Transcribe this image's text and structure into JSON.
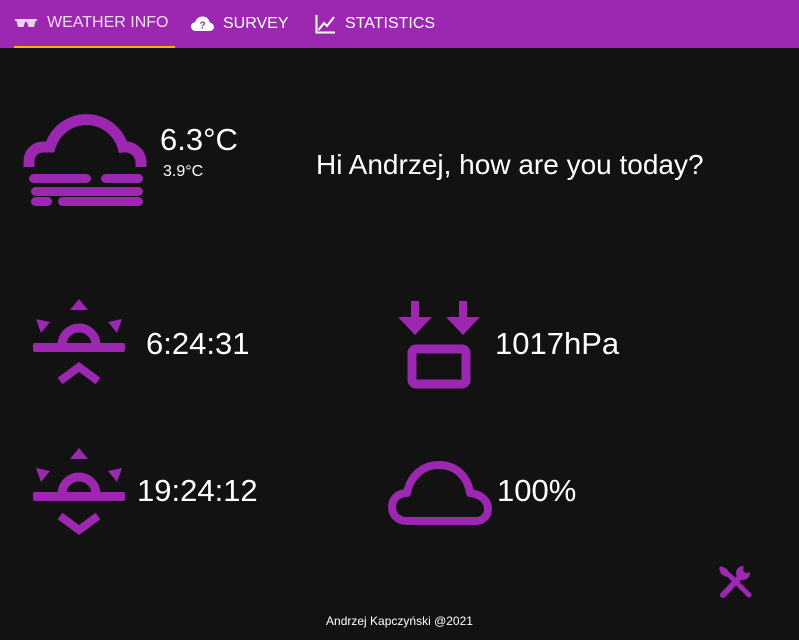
{
  "tabs": [
    {
      "label": "WEATHER INFO",
      "icon": "glasses-icon",
      "active": true
    },
    {
      "label": "SURVEY",
      "icon": "cloud-question-icon",
      "active": false
    },
    {
      "label": "STATISTICS",
      "icon": "chart-line-icon",
      "active": false
    }
  ],
  "weather": {
    "icon": "fog-cloud-icon",
    "temperature": "6.3°C",
    "feels_like": "3.9°C"
  },
  "greeting": "Hi Andrzej, how are you today?",
  "stats": {
    "sunrise": {
      "icon": "sunrise-icon",
      "value": "6:24:31"
    },
    "sunset": {
      "icon": "sunset-icon",
      "value": "19:24:12"
    },
    "pressure": {
      "icon": "pressure-icon",
      "value": "1017hPa"
    },
    "cloudiness": {
      "icon": "cloud-icon",
      "value": "100%"
    }
  },
  "settings_icon": "tools-icon",
  "footer": "Andrzej Kapczyński @2021",
  "colors": {
    "accent": "#9c27b0",
    "tab_indicator": "#ffb300",
    "background": "#121212",
    "text": "#ffffff"
  }
}
